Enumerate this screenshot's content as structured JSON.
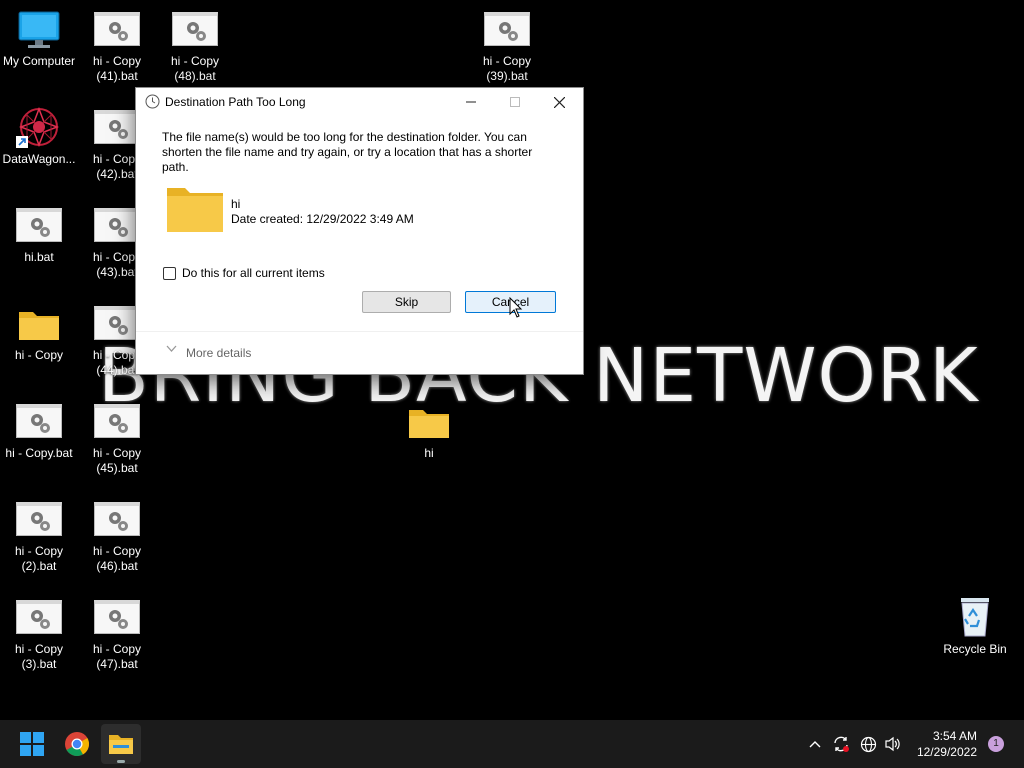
{
  "wallpaper": {
    "text": "BRING BACK NETWORK"
  },
  "desktop": {
    "icons": [
      {
        "label": "My Computer",
        "type": "pc"
      },
      {
        "label": "DataWagon...",
        "type": "shortcut"
      },
      {
        "label": "hi.bat",
        "type": "bat"
      },
      {
        "label": "hi - Copy",
        "type": "folder"
      },
      {
        "label": "hi - Copy.bat",
        "type": "bat"
      },
      {
        "label": "hi - Copy (2).bat",
        "type": "bat"
      },
      {
        "label": "hi - Copy (3).bat",
        "type": "bat"
      },
      {
        "label": "hi - Copy (41).bat",
        "type": "bat"
      },
      {
        "label": "hi - Copy (42).bat",
        "type": "bat"
      },
      {
        "label": "hi - Copy (43).bat",
        "type": "bat"
      },
      {
        "label": "hi - Copy (44).bat",
        "type": "bat"
      },
      {
        "label": "hi - Copy (45).bat",
        "type": "bat"
      },
      {
        "label": "hi - Copy (46).bat",
        "type": "bat"
      },
      {
        "label": "hi - Copy (47).bat",
        "type": "bat"
      },
      {
        "label": "hi - Copy (48).bat",
        "type": "bat"
      },
      {
        "label": "hi - Copy (39).bat",
        "type": "bat"
      },
      {
        "label": "hi",
        "type": "folder"
      },
      {
        "label": "Recycle Bin",
        "type": "recycle"
      }
    ]
  },
  "dialog": {
    "title": "Destination Path Too Long",
    "message": "The file name(s) would be too long for the destination folder. You can shorten the file name and try again, or try a location that has a shorter path.",
    "file_name": "hi",
    "file_date": "Date created: 12/29/2022 3:49 AM",
    "checkbox_label": "Do this for all current items",
    "skip_label": "Skip",
    "cancel_label": "Cancel",
    "details_label": "More details"
  },
  "taskbar": {
    "time": "3:54 AM",
    "date": "12/29/2022",
    "notification_count": "1"
  },
  "colors": {
    "folder": "#f7c948",
    "accent": "#0078d7",
    "taskbar": "#1b1b1b"
  }
}
